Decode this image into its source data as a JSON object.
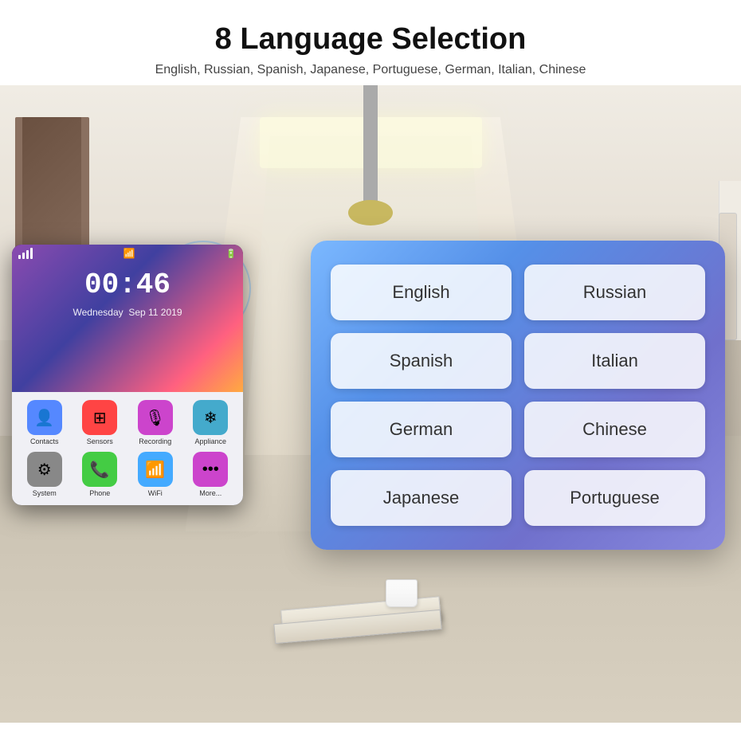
{
  "header": {
    "title": "8 Language Selection",
    "subtitle": "English, Russian, Spanish, Japanese, Portuguese, German, Italian, Chinese"
  },
  "device": {
    "time": "00:46",
    "day": "Wednesday",
    "date": "Sep 11 2019",
    "apps": [
      {
        "label": "Contacts",
        "color": "#5588ff",
        "icon": "👤"
      },
      {
        "label": "Sensors",
        "color": "#ff4444",
        "icon": "⊞"
      },
      {
        "label": "Recording",
        "color": "#cc44cc",
        "icon": "🎙"
      },
      {
        "label": "Appliance",
        "color": "#44aacc",
        "icon": "❄"
      },
      {
        "label": "System",
        "color": "#888888",
        "icon": "⚙"
      },
      {
        "label": "Phone",
        "color": "#44cc44",
        "icon": "📞"
      },
      {
        "label": "WiFi",
        "color": "#44aaff",
        "icon": "📶"
      },
      {
        "label": "More...",
        "color": "#cc44cc",
        "icon": "•••"
      }
    ]
  },
  "languages": {
    "buttons": [
      {
        "id": "english",
        "label": "English"
      },
      {
        "id": "russian",
        "label": "Russian"
      },
      {
        "id": "spanish",
        "label": "Spanish"
      },
      {
        "id": "italian",
        "label": "Italian"
      },
      {
        "id": "german",
        "label": "German"
      },
      {
        "id": "chinese",
        "label": "Chinese"
      },
      {
        "id": "japanese",
        "label": "Japanese"
      },
      {
        "id": "portuguese",
        "label": "Portuguese"
      }
    ]
  }
}
